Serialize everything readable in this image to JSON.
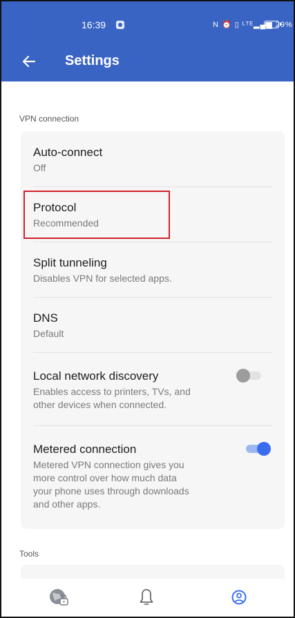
{
  "status_bar": {
    "time": "16:39",
    "icons_text": "N ⏰ ▯ ᴸᵀᴱ▂▄▆ 29%",
    "battery": "29%"
  },
  "app_bar": {
    "back_icon": "arrow-left-icon",
    "title": "Settings"
  },
  "sections": {
    "vpn_connection": "VPN connection",
    "tools": "Tools"
  },
  "settings": {
    "auto_connect": {
      "title": "Auto-connect",
      "value": "Off"
    },
    "protocol": {
      "title": "Protocol",
      "value": "Recommended"
    },
    "split_tunneling": {
      "title": "Split tunneling",
      "value": "Disables VPN for selected apps."
    },
    "dns": {
      "title": "DNS",
      "value": "Default"
    },
    "local_network": {
      "title": "Local network discovery",
      "description_line1": "Enables access to printers, TVs, and",
      "description_line2": "other devices when connected.",
      "enabled": false
    },
    "metered": {
      "title": "Metered connection",
      "description_line1": "Metered VPN connection gives you",
      "description_line2": "more control over how much data",
      "description_line3": "your phone uses through downloads",
      "description_line4": "and other apps.",
      "enabled": true
    }
  },
  "bottom_nav": {
    "items": [
      {
        "icon": "globe-lock-icon",
        "active": false
      },
      {
        "icon": "bell-icon",
        "active": false
      },
      {
        "icon": "profile-icon",
        "active": true
      }
    ]
  },
  "colors": {
    "brand": "#3a64c4",
    "accent": "#3a6cf0",
    "highlight": "#d0202b"
  }
}
